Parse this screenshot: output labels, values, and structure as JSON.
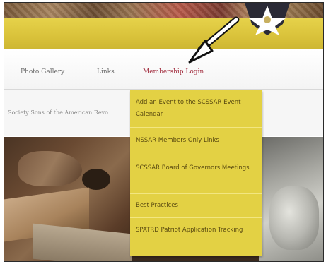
{
  "nav": {
    "items": [
      {
        "label": "Photo Gallery"
      },
      {
        "label": "Links"
      },
      {
        "label": "Membership Login"
      }
    ]
  },
  "subtitle": "Society Sons of the American Revo",
  "dropdown": {
    "items": [
      {
        "label": "Add an Event to the SCSSAR Event Calendar"
      },
      {
        "label": "NSSAR Members Only Links"
      },
      {
        "label": "SCSSAR Board of Governors Meetings"
      },
      {
        "label": "Best Practices"
      },
      {
        "label": "SPATRD Patriot Application Tracking"
      }
    ]
  },
  "icons": {
    "badge": "star-badge-icon",
    "pointer": "pointer-arrow-icon"
  },
  "colors": {
    "header_yellow": "#d9c23a",
    "dropdown_yellow": "#e3d144",
    "active_nav": "#a0283a"
  }
}
